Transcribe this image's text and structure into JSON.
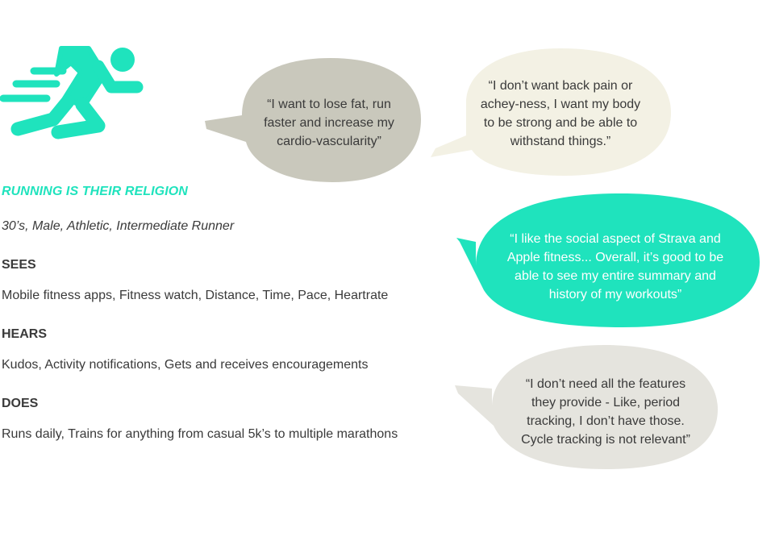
{
  "persona": {
    "title": "RUNNING IS THEIR RELIGION",
    "subtitle": "30’s, Male, Athletic, Intermediate Runner",
    "sections": [
      {
        "heading": "SEES",
        "body": "Mobile fitness apps, Fitness watch,  Distance, Time, Pace, Heartrate"
      },
      {
        "heading": "HEARS",
        "body": "Kudos, Activity notifications, Gets and receives encouragements"
      },
      {
        "heading": "DOES",
        "body": "Runs daily, Trains for anything from casual 5k’s to multiple marathons"
      }
    ]
  },
  "icon": {
    "name": "runner-icon",
    "color": "#1fe3bd"
  },
  "quotes": [
    {
      "text": "“I want to lose fat, run faster and increase my cardio-vascularity”",
      "color": "#c9c8bc"
    },
    {
      "text": "“I don’t want back pain or achey-ness, I want my body to be strong and be able to withstand things.”",
      "color": "#f3f1e4"
    },
    {
      "text": "“I like the social aspect of Strava and Apple fitness... Overall, it’s good to be able to see my entire summary and history of my workouts”",
      "color": "#1fe3bd"
    },
    {
      "text": "“I don’t need all the features they provide - Like, period tracking, I don’t have those. Cycle tracking is not relevant”",
      "color": "#e5e4de"
    }
  ]
}
